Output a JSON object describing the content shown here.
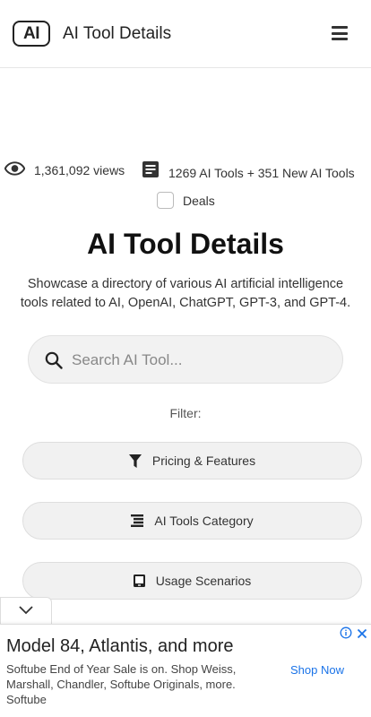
{
  "header": {
    "logo_text": "AI",
    "site_title": "AI Tool Details",
    "menu_icon": "hamburger-menu-icon"
  },
  "stats": {
    "views_icon": "eye-icon",
    "views": "1,361,092 views",
    "tools_icon": "document-icon",
    "tools": "1269 AI Tools + 351 New AI Tools"
  },
  "deals": {
    "label": "Deals",
    "checked": false
  },
  "main": {
    "title": "AI Tool Details",
    "description": "Showcase a directory of various AI artificial intelligence tools related to AI, OpenAI, ChatGPT, GPT-3, and GPT-4."
  },
  "search": {
    "placeholder": "Search AI Tool...",
    "value": ""
  },
  "filter": {
    "label": "Filter:",
    "buttons": [
      {
        "label": "Pricing & Features",
        "icon": "filter-funnel-icon"
      },
      {
        "label": "AI Tools Category",
        "icon": "category-list-icon"
      },
      {
        "label": "Usage Scenarios",
        "icon": "tablet-device-icon"
      }
    ]
  },
  "ad": {
    "title": "Model 84, Atlantis, and more",
    "body": "Softube End of Year Sale is on. Shop Weiss, Marshall, Chandler, Softube Originals, more. Softube",
    "cta": "Shop Now",
    "cta_color": "#1a73e8"
  }
}
